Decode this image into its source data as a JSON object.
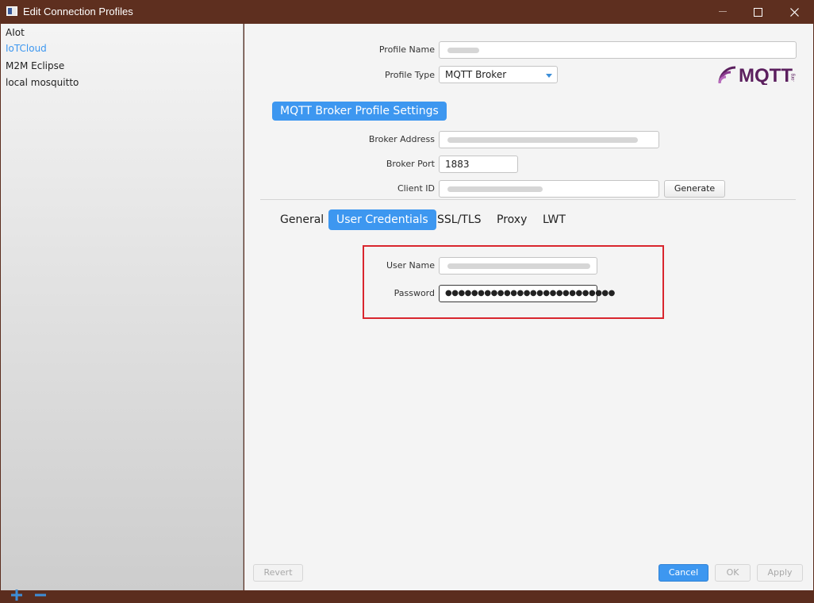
{
  "window": {
    "title": "Edit Connection Profiles"
  },
  "sidebar": {
    "profiles": [
      {
        "label": "AIot",
        "selected": false
      },
      {
        "label": "IoTCloud",
        "selected": true
      },
      {
        "label": "M2M Eclipse",
        "selected": false
      },
      {
        "label": "local mosquitto",
        "selected": false
      }
    ],
    "add_label": "+",
    "remove_label": "−"
  },
  "form": {
    "profile_name_label": "Profile Name",
    "profile_type_label": "Profile Type",
    "profile_type_value": "MQTT Broker",
    "section_title": "MQTT Broker Profile Settings",
    "broker_address_label": "Broker Address",
    "broker_port_label": "Broker Port",
    "broker_port_value": "1883",
    "client_id_label": "Client ID",
    "generate_label": "Generate"
  },
  "logo": {
    "text": "MQTT",
    "subtext": ".org",
    "color": "#5b1f5e"
  },
  "tabs": [
    {
      "label": "General",
      "active": false
    },
    {
      "label": "User Credentials",
      "active": true
    },
    {
      "label": "SSL/TLS",
      "active": false
    },
    {
      "label": "Proxy",
      "active": false
    },
    {
      "label": "LWT",
      "active": false
    }
  ],
  "credentials": {
    "user_name_label": "User Name",
    "password_label": "Password",
    "password_value": "●●●●●●●●●●●●●●●●●●●●●●●●●●"
  },
  "footer": {
    "revert_label": "Revert",
    "cancel_label": "Cancel",
    "ok_label": "OK",
    "apply_label": "Apply"
  },
  "colors": {
    "accent": "#3d97f0",
    "titlebar": "#5e2f1f",
    "highlight_border": "#d9262e"
  }
}
